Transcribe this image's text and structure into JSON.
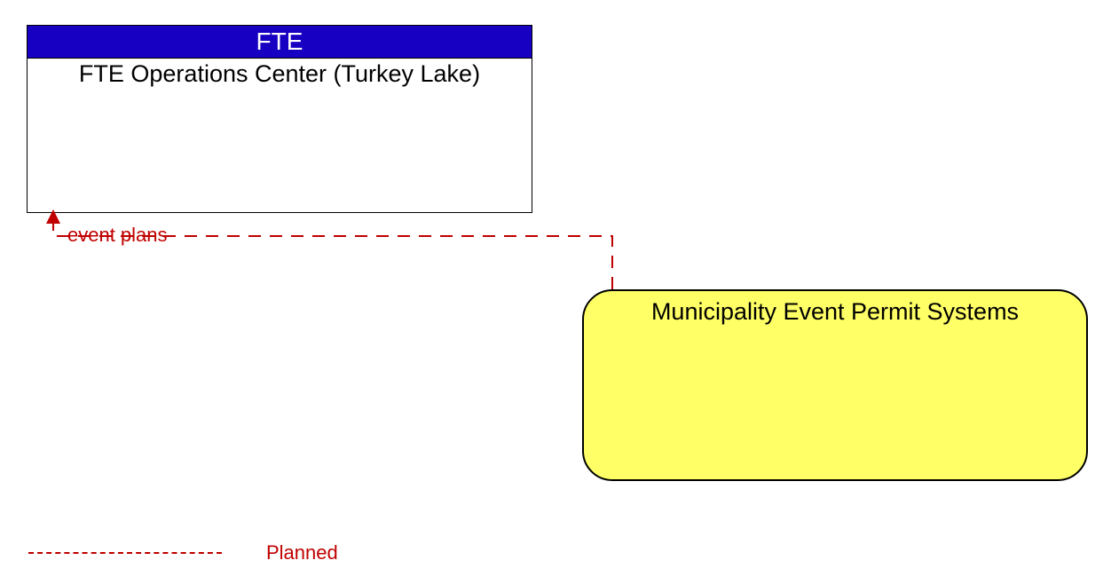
{
  "nodes": {
    "fte": {
      "header": "FTE",
      "body": "FTE Operations Center (Turkey Lake)"
    },
    "muni": {
      "title": "Municipality Event Permit Systems"
    }
  },
  "flows": {
    "event_plans": "event plans"
  },
  "legend": {
    "planned": "Planned"
  },
  "colors": {
    "header_bg": "#1700c2",
    "muni_bg": "#ffff66",
    "flow": "#c00000"
  }
}
